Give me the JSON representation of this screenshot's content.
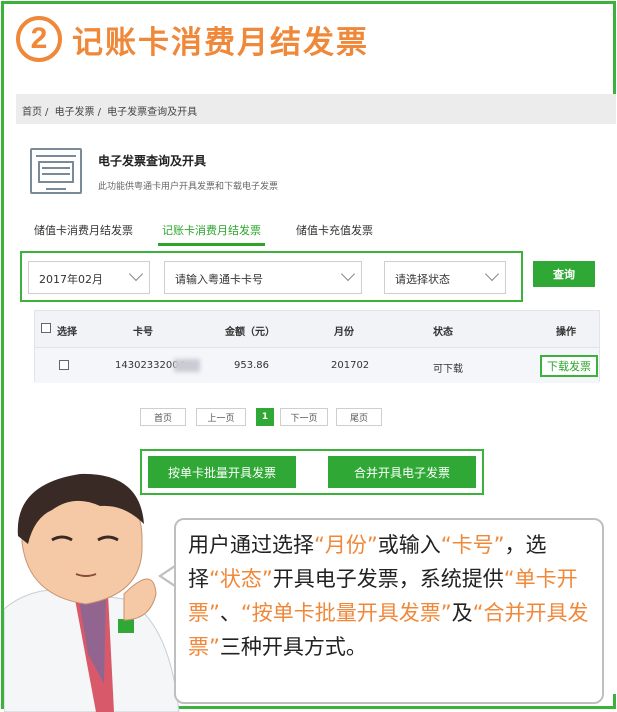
{
  "header": {
    "step_number": "2",
    "title": "记账卡消费月结发票"
  },
  "breadcrumb": [
    "首页",
    "/",
    "电子发票",
    "/",
    "电子发票查询及开具"
  ],
  "section": {
    "title": "电子发票查询及开具",
    "subtitle": "此功能供粤通卡用户开具发票和下载电子发票"
  },
  "tabs": [
    {
      "label": "储值卡消费月结发票",
      "active": false
    },
    {
      "label": "记账卡消费月结发票",
      "active": true
    },
    {
      "label": "储值卡充值发票",
      "active": false
    }
  ],
  "filters": {
    "month": "2017年02月",
    "card_number": "请输入粤通卡卡号",
    "status": "请选择状态",
    "query_button": "查询"
  },
  "table": {
    "headers": [
      "选择",
      "卡号",
      "金额（元）",
      "月份",
      "状态",
      "操作"
    ],
    "rows": [
      {
        "card": "14302332004",
        "amount": "953.86",
        "month": "201702",
        "status": "可下载",
        "action": "下载发票"
      }
    ]
  },
  "pagination": {
    "first": "首页",
    "prev": "上一页",
    "current": "1",
    "next": "下一页",
    "last": "尾页"
  },
  "actions": {
    "batch": "按单卡批量开具发票",
    "merge": "合并开具电子发票"
  },
  "bubble": {
    "parts": [
      {
        "text": "用户通过选择",
        "hl": false
      },
      {
        "text": "“月份”",
        "hl": true
      },
      {
        "text": "或输入",
        "hl": false
      },
      {
        "text": "“卡号”",
        "hl": true
      },
      {
        "text": "，选择",
        "hl": false
      },
      {
        "text": "“状态”",
        "hl": true
      },
      {
        "text": "开具电子发票，系统提供",
        "hl": false
      },
      {
        "text": "“单卡开票”",
        "hl": true
      },
      {
        "text": "、",
        "hl": false
      },
      {
        "text": "“按单卡批量开具发票”",
        "hl": true
      },
      {
        "text": "及",
        "hl": false
      },
      {
        "text": "“合并开具发票”",
        "hl": true
      },
      {
        "text": "三种开具方式。",
        "hl": false
      }
    ]
  },
  "colors": {
    "green": "#2fa835",
    "orange": "#f0883a"
  },
  "icons": [
    "invoice-doc-icon",
    "chevron-down-icon",
    "checkbox-icon"
  ]
}
